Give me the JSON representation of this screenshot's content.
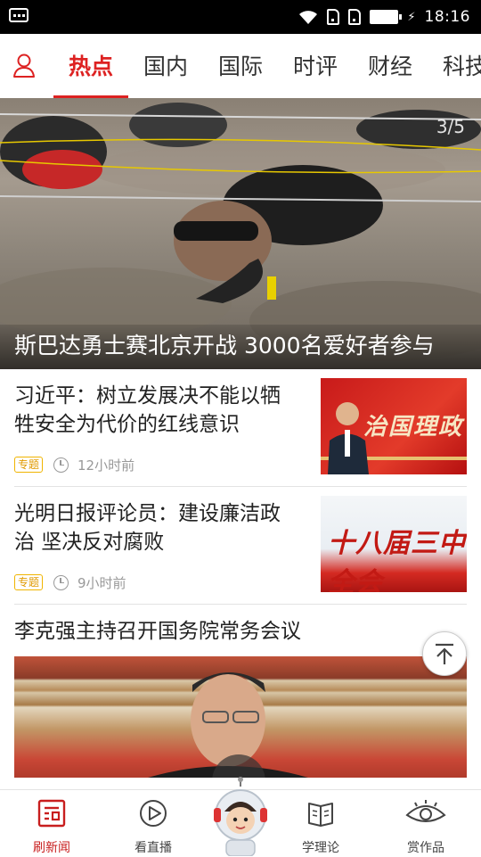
{
  "status_bar": {
    "time": "18:16"
  },
  "top_nav": {
    "tabs": [
      {
        "label": "热点",
        "active": true
      },
      {
        "label": "国内",
        "active": false
      },
      {
        "label": "国际",
        "active": false
      },
      {
        "label": "时评",
        "active": false
      },
      {
        "label": "财经",
        "active": false
      },
      {
        "label": "科技",
        "active": false
      }
    ],
    "active_color": "#dd2222"
  },
  "hero": {
    "caption": "斯巴达勇士赛北京开战 3000名爱好者参与",
    "index": "3/5"
  },
  "articles": [
    {
      "title": "习近平：树立发展决不能以牺牲安全为代价的红线意识",
      "badge": "专题",
      "time": "12小时前",
      "thumb_text": "治国理政"
    },
    {
      "title": "光明日报评论员：建设廉洁政治 坚决反对腐败",
      "badge": "专题",
      "time": "9小时前",
      "thumb_text": "十八届三中全会"
    },
    {
      "title": "李克强主持召开国务院常务会议"
    }
  ],
  "bottom_nav": {
    "items": [
      {
        "label": "刷新闻",
        "active": true,
        "icon": "news-icon"
      },
      {
        "label": "看直播",
        "active": false,
        "icon": "play-icon"
      },
      {
        "label": "学理论",
        "active": false,
        "icon": "book-icon"
      },
      {
        "label": "赏作品",
        "active": false,
        "icon": "eye-icon"
      }
    ],
    "active_color": "#c81e1e"
  }
}
